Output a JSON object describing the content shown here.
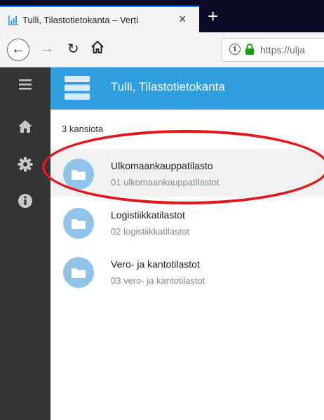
{
  "browser": {
    "tab_title": "Tulli, Tilastotietokanta – Verti",
    "tab_close": "×",
    "new_tab": "+",
    "url_info": "i",
    "url": "https://ulja"
  },
  "app": {
    "title": "Tulli, Tilastotietokanta",
    "accent_color": "#2f9ede",
    "sidebar_color": "#333436"
  },
  "content": {
    "breadcrumb": "3 kansiota",
    "folders": [
      {
        "title": "Ulkomaankauppatilasto",
        "subtitle": "01 ulkomaankauppatilastot",
        "selected": true
      },
      {
        "title": "Logistiikkatilastot",
        "subtitle": "02 logistiikkatilastot",
        "selected": false
      },
      {
        "title": "Vero- ja kantotilastot",
        "subtitle": "03 vero- ja kantotilastot",
        "selected": false
      }
    ]
  },
  "annotation": {
    "color": "#e2161b",
    "shape": "ellipse"
  }
}
